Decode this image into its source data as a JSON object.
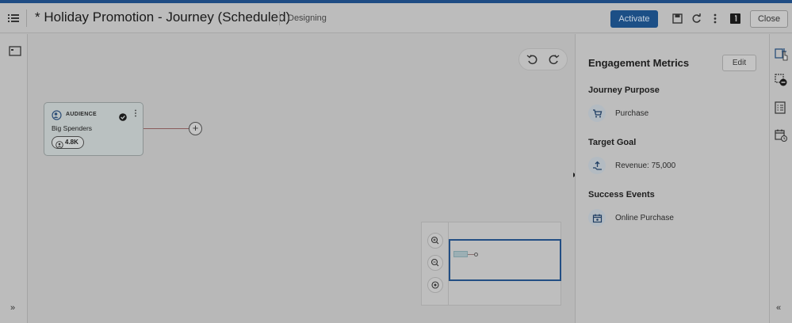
{
  "header": {
    "title": "* Holiday Promotion - Journey (Scheduled)",
    "status": "Designing",
    "activate_label": "Activate",
    "close_label": "Close",
    "icons": [
      "list-icon",
      "save-icon",
      "refresh-icon",
      "more-icon",
      "notification-icon"
    ]
  },
  "canvas": {
    "node": {
      "type": "AUDIENCE",
      "name": "Big Spenders",
      "count": "4.8K"
    }
  },
  "panel": {
    "title": "Engagement Metrics",
    "edit_label": "Edit",
    "sections": [
      {
        "title": "Journey Purpose",
        "value": "Purchase",
        "icon": "cart-icon"
      },
      {
        "title": "Target Goal",
        "value": "Revenue: 75,000",
        "icon": "upload-hand-icon"
      },
      {
        "title": "Success Events",
        "value": "Online Purchase",
        "icon": "event-icon"
      }
    ]
  },
  "colors": {
    "accent": "#1c4f86",
    "topline": "#1f4c84"
  }
}
